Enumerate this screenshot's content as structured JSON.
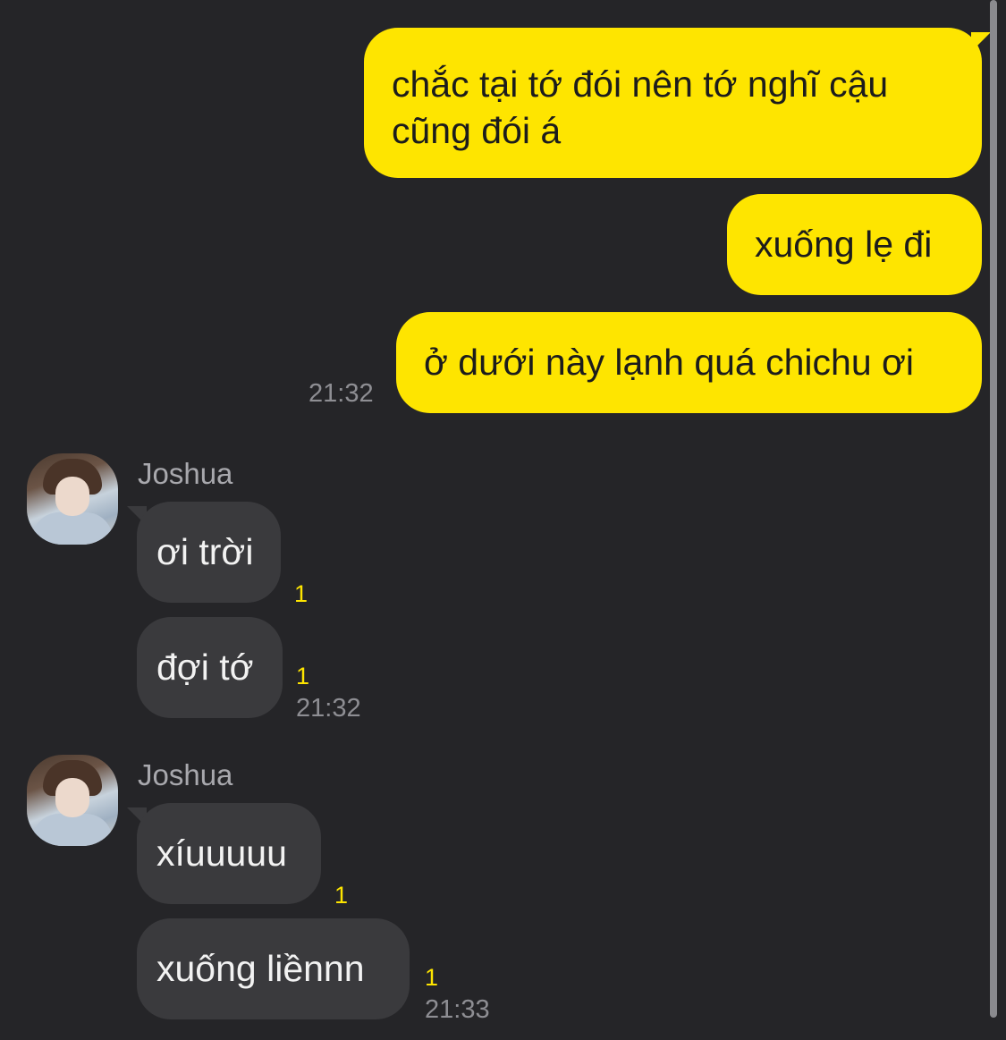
{
  "sent_messages": [
    {
      "line1": "chắc tại tớ đói nên tớ nghĩ cậu",
      "line2": "cũng đói á"
    },
    {
      "text": "xuống lẹ đi"
    },
    {
      "text": "ở dưới này lạnh quá chichu ơi",
      "time": "21:32"
    }
  ],
  "received_groups": [
    {
      "sender": "Joshua",
      "messages": [
        {
          "text": "ơi trời",
          "unread": "1"
        },
        {
          "text": "đợi tớ",
          "unread": "1",
          "time": "21:32"
        }
      ]
    },
    {
      "sender": "Joshua",
      "messages": [
        {
          "text": "xíuuuuu",
          "unread": "1"
        },
        {
          "text": "xuống liềnnn",
          "unread": "1",
          "time": "21:33"
        }
      ]
    }
  ],
  "colors": {
    "background": "#252528",
    "sent_bubble": "#fee500",
    "received_bubble": "#3a3a3d",
    "unread_count": "#fee500"
  }
}
